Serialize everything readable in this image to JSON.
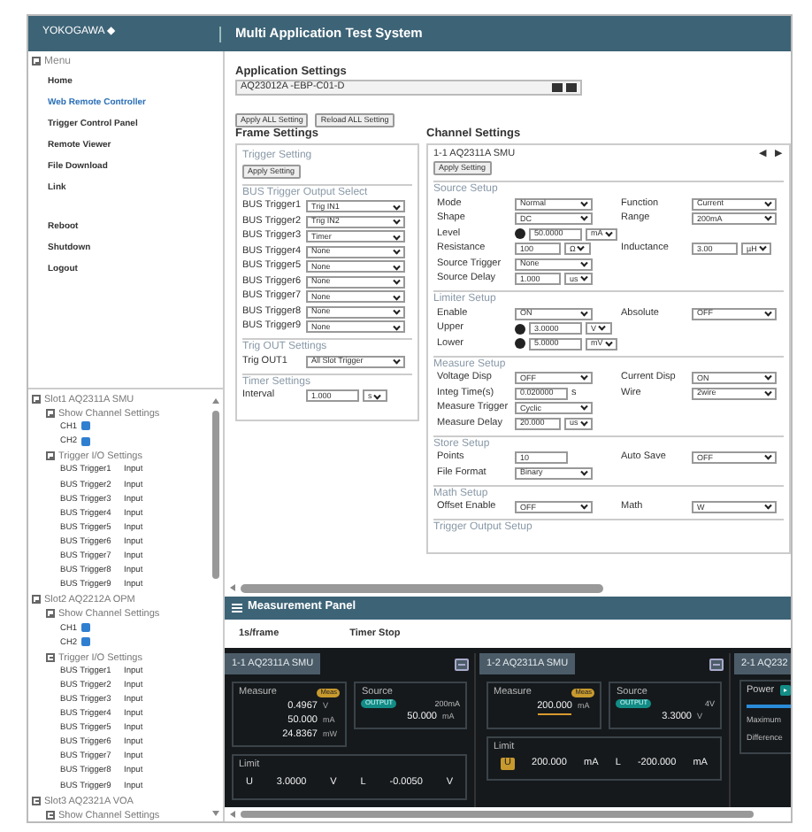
{
  "header": {
    "logo": "YOKOGAWA ◆",
    "title": "Multi Application Test System"
  },
  "menu": {
    "title": "Menu",
    "expanded": true,
    "items": [
      {
        "label": "Home",
        "selected": false
      },
      {
        "label": "Web Remote Controller",
        "selected": true
      },
      {
        "label": "Trigger Control Panel",
        "selected": false
      },
      {
        "label": "Remote Viewer",
        "selected": false
      },
      {
        "label": "File Download",
        "selected": false
      },
      {
        "label": "Link",
        "selected": false
      }
    ],
    "system_items": [
      {
        "label": "Reboot"
      },
      {
        "label": "Shutdown"
      },
      {
        "label": "Logout"
      }
    ]
  },
  "tree": [
    {
      "label": "Slot1 AQ2311A SMU",
      "expanded": true,
      "channel_settings": {
        "label": "Show Channel Settings",
        "expanded": true,
        "channels": [
          {
            "label": "CH1",
            "checked": true
          },
          {
            "label": "CH2",
            "checked": true
          }
        ]
      },
      "trigger_io": {
        "label": "Trigger I/O Settings",
        "expanded": true,
        "triggers": [
          {
            "name": "BUS Trigger1",
            "mode": "Input"
          },
          {
            "name": "BUS Trigger2",
            "mode": "Input"
          },
          {
            "name": "BUS Trigger3",
            "mode": "Input"
          },
          {
            "name": "BUS Trigger4",
            "mode": "Input"
          },
          {
            "name": "BUS Trigger5",
            "mode": "Input"
          },
          {
            "name": "BUS Trigger6",
            "mode": "Input"
          },
          {
            "name": "BUS Trigger7",
            "mode": "Input"
          },
          {
            "name": "BUS Trigger8",
            "mode": "Input"
          },
          {
            "name": "BUS Trigger9",
            "mode": "Input"
          }
        ]
      }
    },
    {
      "label": "Slot2 AQ2212A OPM",
      "expanded": true,
      "channel_settings": {
        "label": "Show Channel Settings",
        "expanded": true,
        "channels": [
          {
            "label": "CH1",
            "checked": true
          },
          {
            "label": "CH2",
            "checked": true
          }
        ]
      },
      "trigger_io": {
        "label": "Trigger I/O Settings",
        "expanded": true,
        "triggers": [
          {
            "name": "BUS Trigger1",
            "mode": "Input"
          },
          {
            "name": "BUS Trigger2",
            "mode": "Input"
          },
          {
            "name": "BUS Trigger3",
            "mode": "Input"
          },
          {
            "name": "BUS Trigger4",
            "mode": "Input"
          },
          {
            "name": "BUS Trigger5",
            "mode": "Input"
          },
          {
            "name": "BUS Trigger6",
            "mode": "Input"
          },
          {
            "name": "BUS Trigger7",
            "mode": "Input"
          },
          {
            "name": "BUS Trigger8",
            "mode": "Input"
          },
          {
            "name": "BUS Trigger9",
            "mode": "Input"
          }
        ]
      }
    },
    {
      "label": "Slot3 AQ2321A VOA",
      "expanded": true,
      "channel_settings": {
        "label": "Show Channel Settings",
        "expanded": true
      }
    }
  ],
  "application_settings": {
    "title": "Application Settings",
    "file": "AQ23012A -EBP-C01-D",
    "buttons": [
      "Apply ALL Setting",
      "Reload ALL Setting"
    ]
  },
  "frame_settings": {
    "title": "Frame Settings",
    "trigger_setting": {
      "title": "Trigger Setting",
      "button": "Apply Setting"
    },
    "bus_output": {
      "title": "BUS Trigger Output Select",
      "rows": [
        {
          "label": "BUS Trigger1",
          "value": "Trig IN1"
        },
        {
          "label": "BUS Trigger2",
          "value": "Trig IN2"
        },
        {
          "label": "BUS Trigger3",
          "value": "Timer"
        },
        {
          "label": "BUS Trigger4",
          "value": "None"
        },
        {
          "label": "BUS Trigger5",
          "value": "None"
        },
        {
          "label": "BUS Trigger6",
          "value": "None"
        },
        {
          "label": "BUS Trigger7",
          "value": "None"
        },
        {
          "label": "BUS Trigger8",
          "value": "None"
        },
        {
          "label": "BUS Trigger9",
          "value": "None"
        }
      ]
    },
    "trig_out": {
      "title": "Trig OUT Settings",
      "rows": [
        {
          "label": "Trig OUT1",
          "value": "All Slot Trigger"
        }
      ]
    },
    "timer": {
      "title": "Timer Settings",
      "label": "Interval",
      "value": "1.000",
      "unit": "s"
    }
  },
  "channel_settings": {
    "title": "Channel Settings",
    "channel": "1-1 AQ2311A SMU",
    "prev": "◀",
    "next": "▶",
    "button": "Apply Setting",
    "sections": [
      {
        "title": "Source Setup",
        "rows": [
          [
            {
              "label": "Mode",
              "kind": "select",
              "value": "Normal"
            },
            {
              "label": "Function",
              "kind": "select",
              "value": "Current"
            }
          ],
          [
            {
              "label": "Shape",
              "kind": "select",
              "value": "DC"
            },
            {
              "label": "Range",
              "kind": "select",
              "value": "200mA"
            }
          ],
          [
            {
              "label": "Level",
              "kind": "signed",
              "value": "50.0000",
              "unit": "mA"
            }
          ],
          [
            {
              "label": "Resistance",
              "kind": "input_unit",
              "value": "100",
              "unit": "Ω"
            },
            {
              "label": "Inductance",
              "kind": "input_unit",
              "value": "3.00",
              "unit": "µH"
            }
          ],
          [
            {
              "label": "Source Trigger",
              "kind": "select",
              "value": "None"
            }
          ],
          [
            {
              "label": "Source Delay",
              "kind": "input_unit",
              "value": "1.000",
              "unit": "us"
            }
          ]
        ]
      },
      {
        "title": "Limiter Setup",
        "rows": [
          [
            {
              "label": "Enable",
              "kind": "select",
              "value": "ON"
            },
            {
              "label": "Absolute",
              "kind": "select",
              "value": "OFF"
            }
          ],
          [
            {
              "label": "Upper",
              "kind": "signed",
              "value": "3.0000",
              "unit": "V"
            }
          ],
          [
            {
              "label": "Lower",
              "kind": "signed",
              "value": "5.0000",
              "unit": "mV"
            }
          ]
        ]
      },
      {
        "title": "Measure Setup",
        "rows": [
          [
            {
              "label": "Voltage Disp",
              "kind": "select",
              "value": "OFF"
            },
            {
              "label": "Current Disp",
              "kind": "select",
              "value": "ON"
            }
          ],
          [
            {
              "label": "Integ Time(s)",
              "kind": "input_text",
              "value": "0.020000",
              "unit": "s"
            },
            {
              "label": "Wire",
              "kind": "select",
              "value": "2wire"
            }
          ],
          [
            {
              "label": "Measure Trigger",
              "kind": "select",
              "value": "Cyclic"
            }
          ],
          [
            {
              "label": "Measure Delay",
              "kind": "input_unit",
              "value": "20.000",
              "unit": "us"
            }
          ]
        ]
      },
      {
        "title": "Store Setup",
        "rows": [
          [
            {
              "label": "Points",
              "kind": "input",
              "value": "10"
            },
            {
              "label": "Auto Save",
              "kind": "select",
              "value": "OFF"
            }
          ],
          [
            {
              "label": "File Format",
              "kind": "select",
              "value": "Binary"
            }
          ]
        ]
      },
      {
        "title": "Math Setup",
        "rows": [
          [
            {
              "label": "Offset Enable",
              "kind": "select",
              "value": "OFF"
            },
            {
              "label": "Math",
              "kind": "select",
              "value": "W"
            }
          ]
        ]
      },
      {
        "title": "Trigger Output Setup"
      }
    ]
  },
  "measurement_panel": {
    "title": "Measurement Panel",
    "frame_rate": "1s/frame",
    "timer": "Timer Stop",
    "cards": [
      {
        "kind": "smu",
        "title": "1-1 AQ2311A SMU",
        "measure": {
          "label": "Measure",
          "badge": "Meas",
          "readings": [
            {
              "value": "0.4967",
              "unit": "V",
              "highlighted": false
            },
            {
              "value": "50.000",
              "unit": "mA",
              "highlighted": false
            },
            {
              "value": "24.8367",
              "unit": "mW",
              "highlighted": false
            }
          ]
        },
        "source": {
          "label": "Source",
          "badge": "OUTPUT",
          "range": "200mA",
          "readings": [
            {
              "value": "50.000",
              "unit": "mA"
            }
          ]
        },
        "limit": {
          "label": "Limit",
          "upper_label": "U",
          "upper_active": false,
          "upper": "3.0000",
          "upper_unit": "V",
          "lower_label": "L",
          "lower": "-0.0050",
          "lower_unit": "V"
        }
      },
      {
        "kind": "smu",
        "title": "1-2 AQ2311A SMU",
        "measure": {
          "label": "Measure",
          "badge": "Meas",
          "readings": [
            {
              "value": "200.000",
              "unit": "mA",
              "highlighted": true
            }
          ]
        },
        "source": {
          "label": "Source",
          "badge": "OUTPUT",
          "range": "4V",
          "readings": [
            {
              "value": "3.3000",
              "unit": "V"
            }
          ]
        },
        "limit": {
          "label": "Limit",
          "upper_label": "U",
          "upper_active": true,
          "upper": "200.000",
          "upper_unit": "mA",
          "lower_label": "L",
          "lower": "-200.000",
          "lower_unit": "mA"
        }
      },
      {
        "kind": "power",
        "title": "2-1 AQ232",
        "items": [
          "Power",
          "Maximum",
          "Difference"
        ]
      }
    ]
  }
}
